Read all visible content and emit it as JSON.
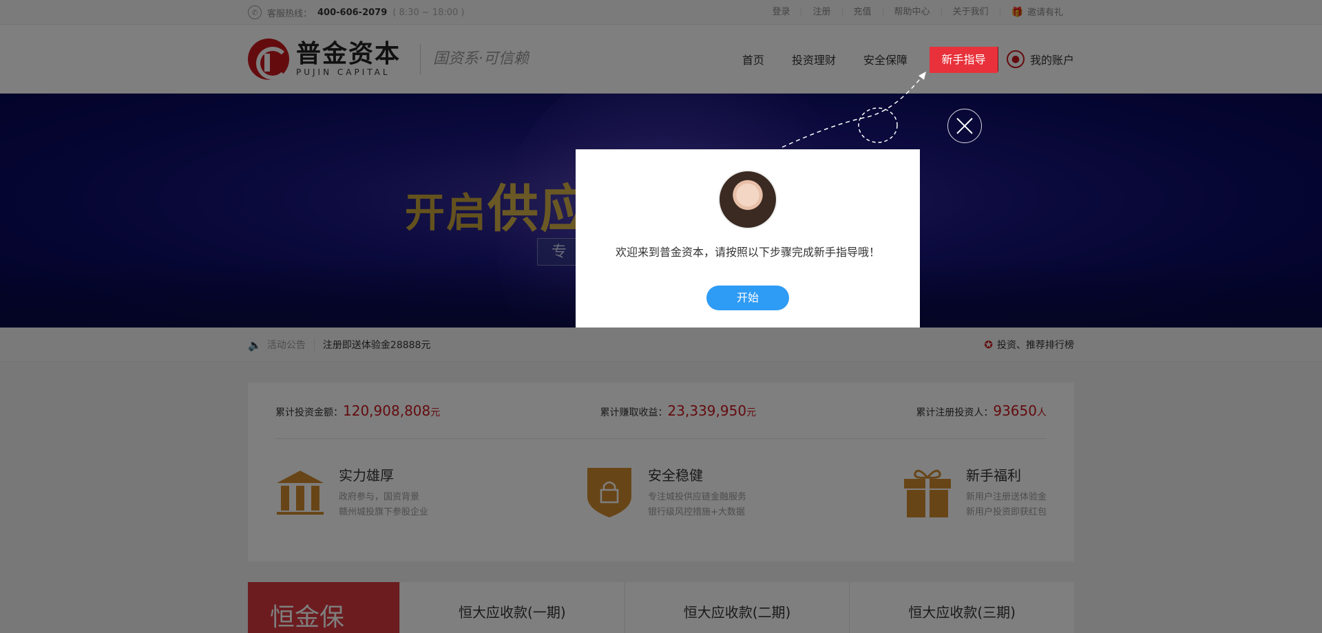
{
  "topbar": {
    "hotline_label": "客服热线：",
    "hotline_number": "400-606-2079",
    "hotline_hours": "( 8:30 ~ 18:00 )",
    "links": [
      "登录",
      "注册",
      "充值",
      "帮助中心",
      "关于我们",
      "邀请有礼"
    ]
  },
  "header": {
    "logo_cn": "普金资本",
    "logo_en": "PUJIN CAPITAL",
    "slogan": "国资系·可信赖",
    "nav": [
      "首页",
      "投资理财",
      "安全保障"
    ],
    "guide_label": "新手指导",
    "account_label": "我的账户"
  },
  "banner": {
    "headline_part1": "开启",
    "headline_part2": "供应",
    "sub": "专"
  },
  "notice": {
    "tag": "活动公告",
    "message": "注册即送体验金28888元",
    "ranking": "投资、推荐排行榜"
  },
  "stats": {
    "invest_label": "累计投资金额：",
    "invest_value": "120,908,808",
    "invest_unit": "元",
    "earn_label": "累计赚取收益：",
    "earn_value": "23,339,950",
    "earn_unit": "元",
    "users_label": "累计注册投资人：",
    "users_value": "93650",
    "users_unit": "人"
  },
  "features": [
    {
      "title": "实力雄厚",
      "line1": "政府参与，国资背景",
      "line2": "赣州城投旗下参股企业",
      "icon": "bank-icon"
    },
    {
      "title": "安全稳健",
      "line1": "专注城投供应链金融服务",
      "line2": "银行级风控措施+大数据",
      "icon": "shield-lock-icon"
    },
    {
      "title": "新手福利",
      "line1": "新用户注册送体验金",
      "line2": "新用户投资即获红包",
      "icon": "gift-icon"
    }
  ],
  "products": {
    "brand": "恒金保",
    "tabs": [
      "恒大应收款(一期)",
      "恒大应收款(二期)",
      "恒大应收款(三期)"
    ]
  },
  "modal": {
    "welcome": "欢迎来到普金资本，请按照以下步骤完成新手指导哦！",
    "start_label": "开始"
  },
  "colors": {
    "brand_red": "#c8161d",
    "guide_red": "#e8313a",
    "start_blue": "#2e9bf5",
    "feature_orange": "#d08a2e"
  }
}
